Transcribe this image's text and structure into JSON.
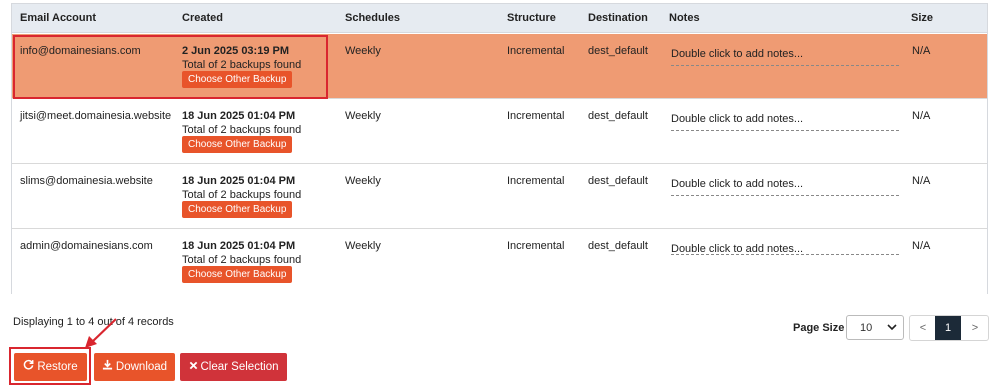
{
  "table": {
    "headers": [
      "Email Account",
      "Created",
      "Schedules",
      "Structure",
      "Destination",
      "Notes",
      "Size"
    ],
    "rows": [
      {
        "email": "info@domainesians.com",
        "created": "2 Jun 2025 03:19 PM",
        "backups": "Total of 2 backups found",
        "choose": "Choose Other Backup",
        "schedule": "Weekly",
        "structure": "Incremental",
        "destination": "dest_default",
        "notes": "Double click to add notes...",
        "size": "N/A",
        "selected": true
      },
      {
        "email": "jitsi@meet.domainesia.website",
        "created": "18 Jun 2025 01:04 PM",
        "backups": "Total of 2 backups found",
        "choose": "Choose Other Backup",
        "schedule": "Weekly",
        "structure": "Incremental",
        "destination": "dest_default",
        "notes": "Double click to add notes...",
        "size": "N/A",
        "selected": false
      },
      {
        "email": "slims@domainesia.website",
        "created": "18 Jun 2025 01:04 PM",
        "backups": "Total of 2 backups found",
        "choose": "Choose Other Backup",
        "schedule": "Weekly",
        "structure": "Incremental",
        "destination": "dest_default",
        "notes": "Double click to add notes...",
        "size": "N/A",
        "selected": false
      },
      {
        "email": "admin@domainesians.com",
        "created": "18 Jun 2025 01:04 PM",
        "backups": "Total of 2 backups found",
        "choose": "Choose Other Backup",
        "schedule": "Weekly",
        "structure": "Incremental",
        "destination": "dest_default",
        "notes": "Double click to add notes...",
        "size": "N/A",
        "selected": false
      }
    ]
  },
  "footer": {
    "records": "Displaying 1 to 4 out of 4 records",
    "page_size_label": "Page Size",
    "page_size_value": "10",
    "pager": {
      "prev": "<",
      "current": "1",
      "next": ">"
    }
  },
  "actions": {
    "restore": "Restore",
    "download": "Download",
    "clear": "Clear Selection"
  },
  "icons": {
    "restore": "refresh-icon",
    "download": "download-icon",
    "clear": "times-icon"
  },
  "colors": {
    "selected_row": "#ef9b73",
    "accent": "#e8542a",
    "danger": "#d0333a",
    "annotation": "#d9262f"
  }
}
